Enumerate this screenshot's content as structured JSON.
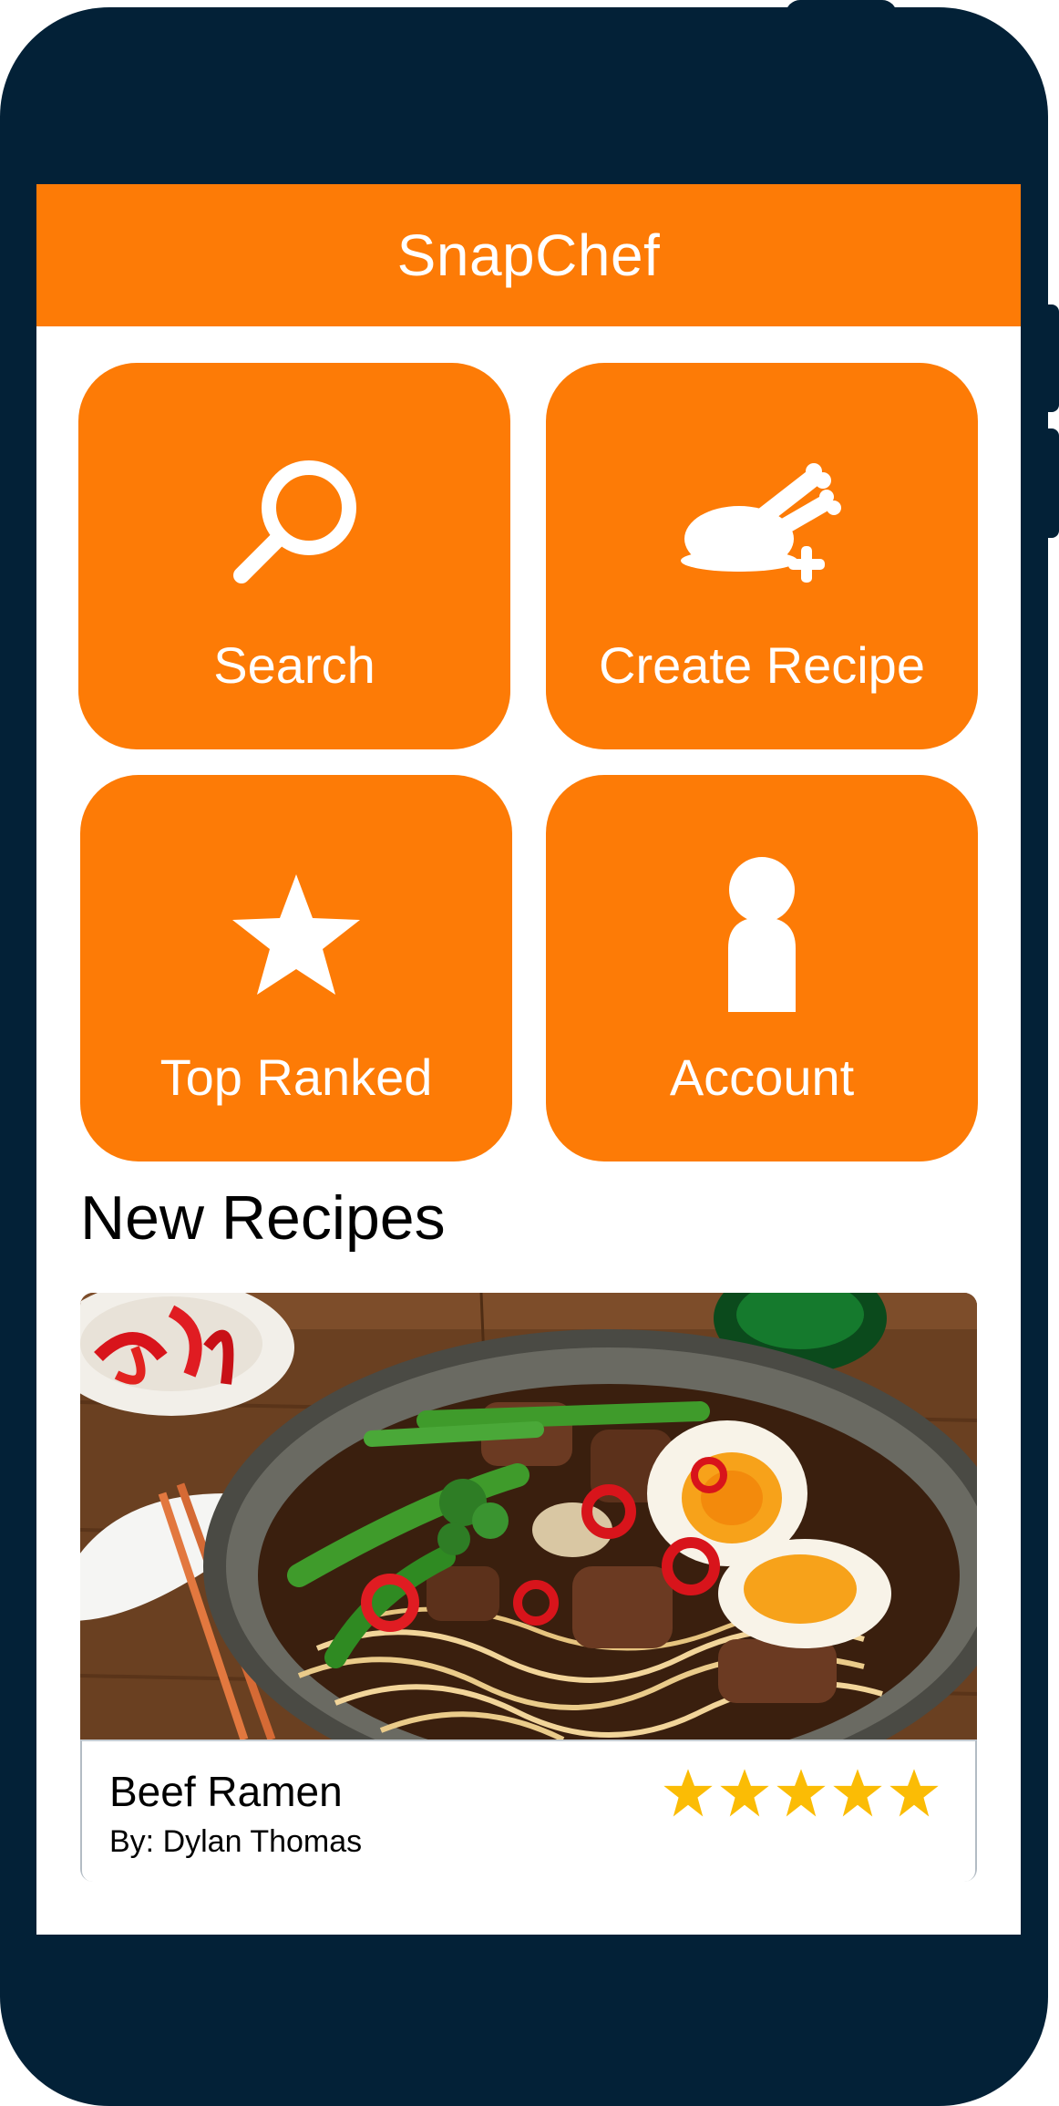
{
  "app": {
    "title": "SnapChef"
  },
  "tiles": [
    {
      "label": "Search",
      "icon": "search-icon"
    },
    {
      "label": "Create Recipe",
      "icon": "chicken-plus-icon"
    },
    {
      "label": "Top Ranked",
      "icon": "star-icon"
    },
    {
      "label": "Account",
      "icon": "person-icon"
    }
  ],
  "new_recipes": {
    "title": "New Recipes",
    "items": [
      {
        "name": "Beef Ramen",
        "author": "By: Dylan Thomas",
        "rating": 5,
        "rating_max": 5,
        "image": "beef-ramen-photo"
      }
    ]
  },
  "colors": {
    "accent": "#fd7b06",
    "device": "#032137",
    "star": "#fbbc05"
  }
}
